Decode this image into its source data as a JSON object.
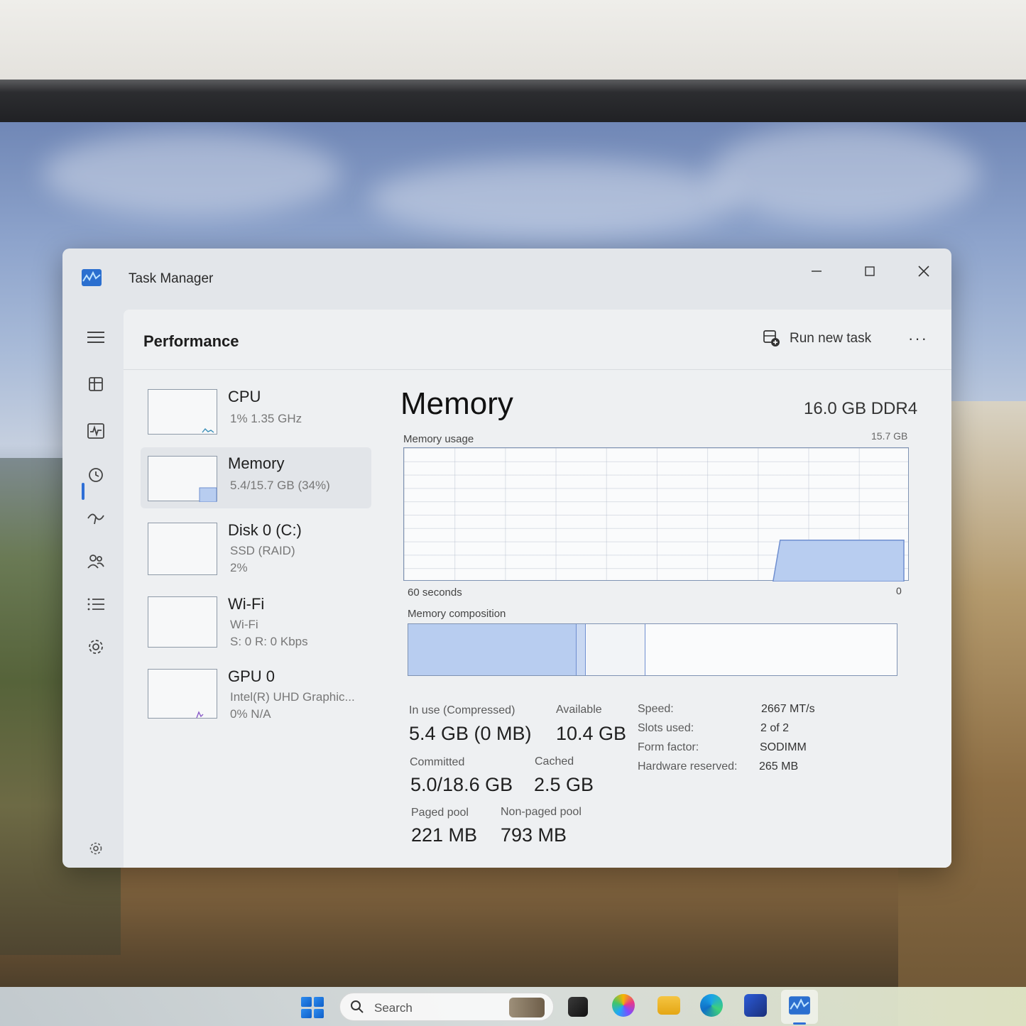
{
  "window": {
    "title": "Task Manager"
  },
  "header": {
    "title": "Performance",
    "run_new_task": "Run new task",
    "more": "···"
  },
  "devices": [
    {
      "name": "CPU",
      "sub1": "1%  1.35 GHz",
      "sub2": ""
    },
    {
      "name": "Memory",
      "sub1": "5.4/15.7 GB (34%)",
      "sub2": ""
    },
    {
      "name": "Disk 0 (C:)",
      "sub1": "SSD (RAID)",
      "sub2": "2%"
    },
    {
      "name": "Wi-Fi",
      "sub1": "Wi-Fi",
      "sub2": "S: 0  R: 0 Kbps"
    },
    {
      "name": "GPU 0",
      "sub1": "Intel(R) UHD Graphic...",
      "sub2": "0%  N/A"
    }
  ],
  "detail": {
    "title": "Memory",
    "type": "16.0 GB DDR4",
    "usage_label": "Memory usage",
    "usage_max": "15.7 GB",
    "axis_left": "60 seconds",
    "axis_right": "0",
    "composition_label": "Memory composition",
    "stats": {
      "in_use_label": "In use (Compressed)",
      "in_use": "5.4 GB (0 MB)",
      "available_label": "Available",
      "available": "10.4 GB",
      "committed_label": "Committed",
      "committed": "5.0/18.6 GB",
      "cached_label": "Cached",
      "cached": "2.5 GB",
      "paged_label": "Paged pool",
      "paged": "221 MB",
      "nonpaged_label": "Non-paged pool",
      "nonpaged": "793 MB"
    },
    "specs": [
      {
        "k": "Speed:",
        "v": "2667 MT/s"
      },
      {
        "k": "Slots used:",
        "v": "2 of 2"
      },
      {
        "k": "Form factor:",
        "v": "SODIMM"
      },
      {
        "k": "Hardware reserved:",
        "v": "265 MB"
      }
    ]
  },
  "taskbar": {
    "search_placeholder": "Search"
  },
  "colors": {
    "accent": "#2f6fd6",
    "memory_fill": "#b8cdf0",
    "memory_line": "#6f8fd0"
  },
  "chart_data": {
    "type": "area",
    "x_label": "60 seconds",
    "y_max_label": "15.7 GB",
    "ylim": [
      0,
      15.7
    ],
    "in_use_gb": 5.4,
    "total_gb": 15.7,
    "composition": {
      "in_use_gb": 5.4,
      "modified_gb": 0.3,
      "standby_gb": 1.9,
      "free_gb": 8.1
    }
  }
}
